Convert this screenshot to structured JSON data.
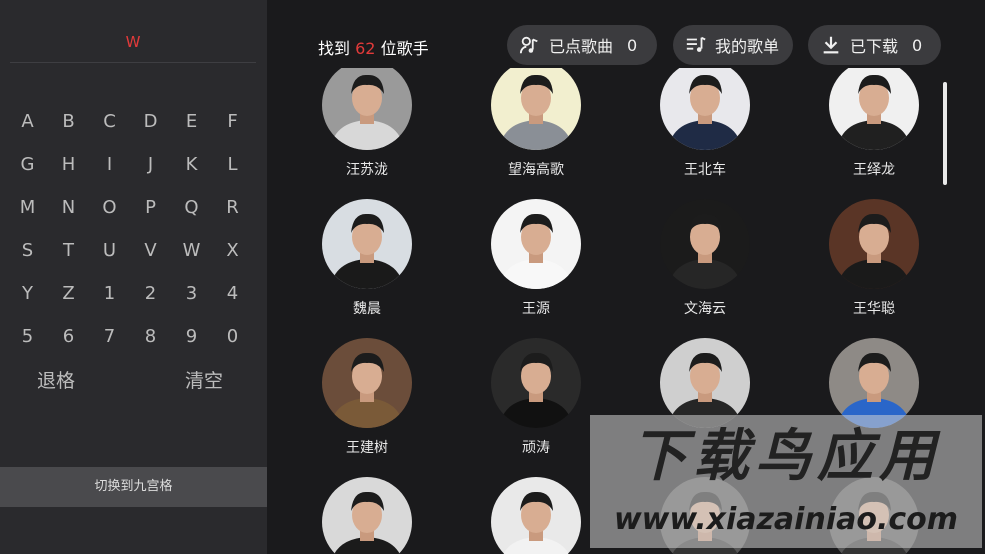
{
  "keyboard": {
    "query": "W",
    "keys": [
      "A",
      "B",
      "C",
      "D",
      "E",
      "F",
      "G",
      "H",
      "I",
      "J",
      "K",
      "L",
      "M",
      "N",
      "O",
      "P",
      "Q",
      "R",
      "S",
      "T",
      "U",
      "V",
      "W",
      "X",
      "Y",
      "Z",
      "1",
      "2",
      "3",
      "4",
      "5",
      "6",
      "7",
      "8",
      "9",
      "0"
    ],
    "backspace_label": "退格",
    "clear_label": "清空",
    "switch_label": "切换到九宫格"
  },
  "header": {
    "found_prefix": "找到",
    "found_count": "62",
    "found_suffix": "位歌手",
    "requested_label": "已点歌曲",
    "requested_count": "0",
    "playlist_label": "我的歌单",
    "downloaded_label": "已下载",
    "downloaded_count": "0"
  },
  "singers": [
    {
      "name": "汪苏泷",
      "bg": "#9a9a9a",
      "shirt": "#d8d8d8"
    },
    {
      "name": "望海高歌",
      "bg": "#f2efcf",
      "shirt": "#8a8f96"
    },
    {
      "name": "王北车",
      "bg": "#e8e8ec",
      "shirt": "#1f2b45"
    },
    {
      "name": "王绎龙",
      "bg": "#f0f0f0",
      "shirt": "#202020"
    },
    {
      "name": "魏晨",
      "bg": "#d8dde2",
      "shirt": "#1a1a1a"
    },
    {
      "name": "王源",
      "bg": "#f4f4f4",
      "shirt": "#f8f8f8"
    },
    {
      "name": "文海云",
      "bg": "#1b1b1b",
      "shirt": "#262626"
    },
    {
      "name": "王华聪",
      "bg": "#5a3526",
      "shirt": "#1a1a1a"
    },
    {
      "name": "王建树",
      "bg": "#6b4d3a",
      "shirt": "#7a5a38"
    },
    {
      "name": "顽涛",
      "bg": "#2a2a2a",
      "shirt": "#111111"
    },
    {
      "name": "",
      "bg": "#cfcfcf",
      "shirt": "#262626"
    },
    {
      "name": "",
      "bg": "#8e8a86",
      "shirt": "#2a66c9"
    },
    {
      "name": "",
      "bg": "#d9d9d9",
      "shirt": "#1b1b1b"
    },
    {
      "name": "",
      "bg": "#e9e9e9",
      "shirt": "#f2f2f2"
    },
    {
      "name": "",
      "bg": "#555555",
      "shirt": "#333333"
    },
    {
      "name": "",
      "bg": "#555555",
      "shirt": "#333333"
    }
  ],
  "watermark": {
    "title": "下载鸟应用",
    "url": "www.xiazainiao.com"
  },
  "colors": {
    "accent": "#e23a3a",
    "panel": "#2a2a2d",
    "background": "#1a1a1c",
    "pill": "#3b3b3e"
  }
}
